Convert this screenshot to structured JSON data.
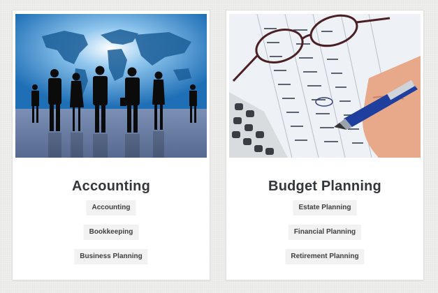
{
  "cards": [
    {
      "title": "Accounting",
      "image": "business-people-world-map",
      "tags": [
        "Accounting",
        "Bookkeeping",
        "Business Planning"
      ]
    },
    {
      "title": "Budget Planning",
      "image": "glasses-calculator-pen-on-spreadsheet",
      "tags": [
        "Estate Planning",
        "Financial Planning",
        "Retirement Planning"
      ]
    }
  ],
  "colors": {
    "title": "#33363a",
    "tag_bg": "#f2f2f2",
    "page_bg": "#eeeeec"
  }
}
